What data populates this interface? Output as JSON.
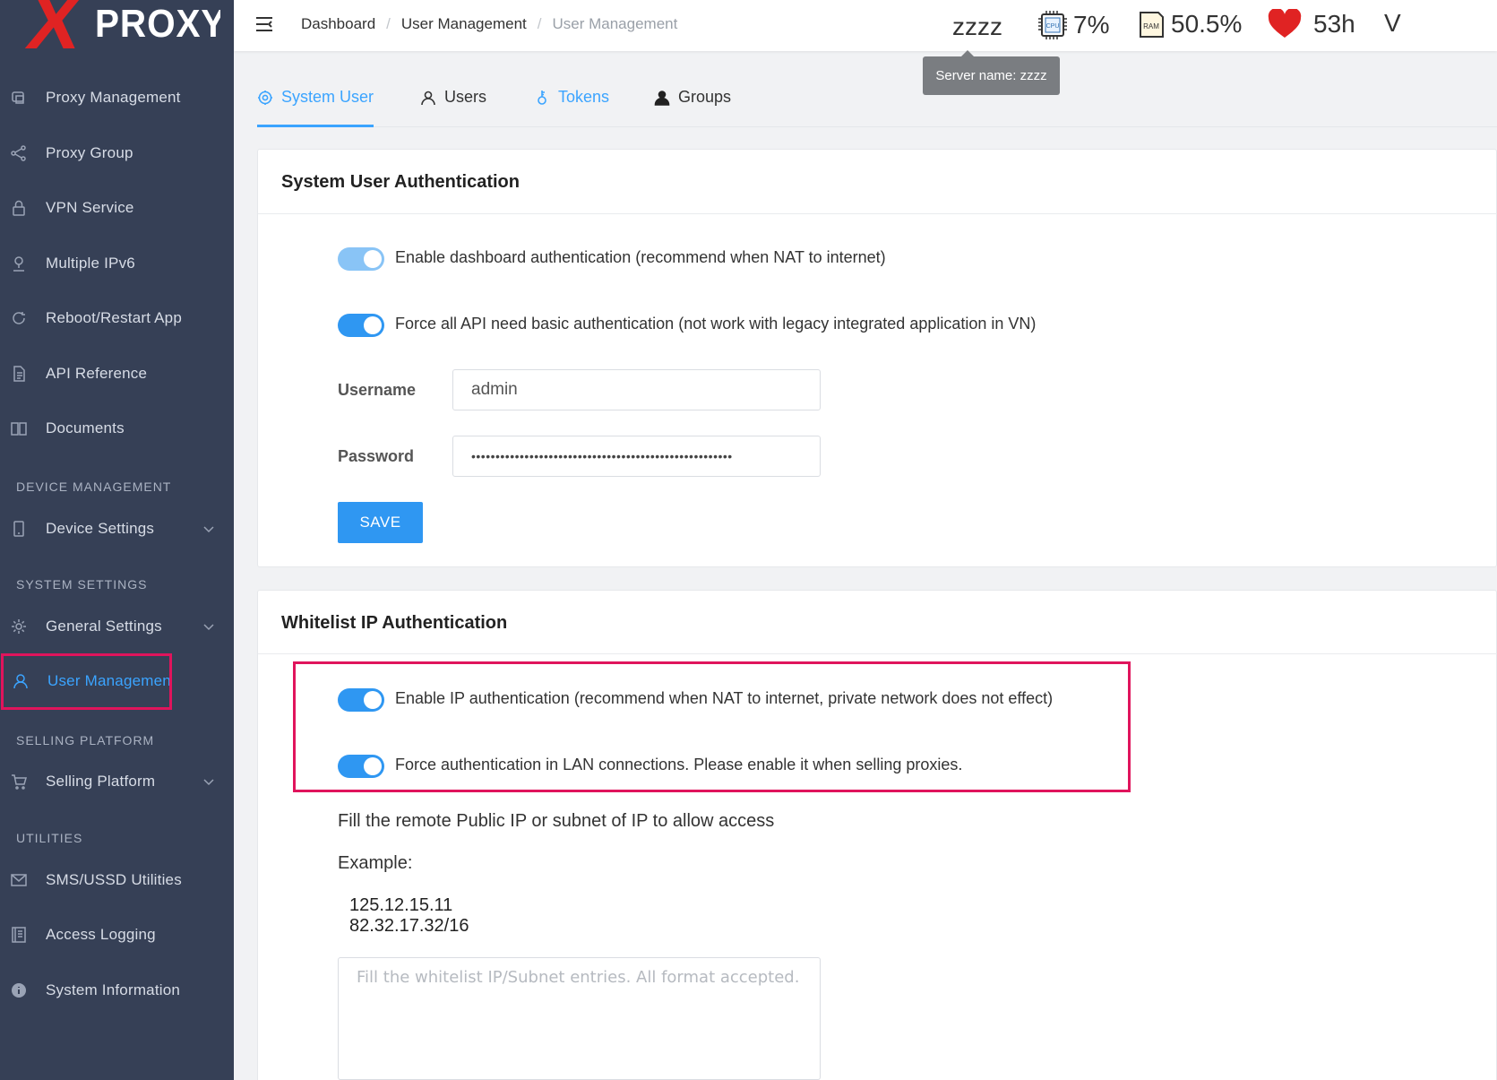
{
  "logo": {
    "x_letter": "X",
    "text": "PROXY"
  },
  "sidebar": {
    "items": [
      {
        "label": "Proxy Management",
        "icon": "proxy-management-icon"
      },
      {
        "label": "Proxy Group",
        "icon": "share-icon"
      },
      {
        "label": "VPN Service",
        "icon": "lock-icon"
      },
      {
        "label": "Multiple IPv6",
        "icon": "user-pin-icon"
      },
      {
        "label": "Reboot/Restart App",
        "icon": "refresh-icon"
      },
      {
        "label": "API Reference",
        "icon": "document-icon"
      },
      {
        "label": "Documents",
        "icon": "book-icon"
      }
    ],
    "sections": {
      "device": "DEVICE MANAGEMENT",
      "system": "SYSTEM SETTINGS",
      "selling": "SELLING PLATFORM",
      "utilities": "UTILITIES"
    },
    "device_settings": "Device Settings",
    "general_settings": "General Settings",
    "user_management": "User Management",
    "selling_platform": "Selling Platform",
    "sms_ussd": "SMS/USSD Utilities",
    "access_logging": "Access Logging",
    "system_information": "System Information"
  },
  "topbar": {
    "breadcrumbs": [
      "Dashboard",
      "User Management",
      "User Management"
    ],
    "server": "zzzz",
    "cpu": "7%",
    "ram": "50.5%",
    "uptime": "53h",
    "version_partial": "V",
    "tooltip": "Server name: zzzz"
  },
  "tabs": [
    "System User",
    "Users",
    "Tokens",
    "Groups"
  ],
  "system_user_auth": {
    "title": "System User Authentication",
    "toggle_dashboard": "Enable dashboard authentication (recommend when NAT to internet)",
    "toggle_api": "Force all API need basic authentication (not work with legacy integrated application in VN)",
    "username_label": "Username",
    "username_value": "admin",
    "password_label": "Password",
    "password_value": "••••••••••••••••••••••••••••••••••••••••••••••••••••••",
    "save_label": "SAVE"
  },
  "whitelist_auth": {
    "title": "Whitelist IP Authentication",
    "toggle_ip": "Enable IP authentication (recommend when NAT to internet, private network does not effect)",
    "toggle_lan": "Force authentication in LAN connections. Please enable it when selling proxies.",
    "hint": "Fill the remote Public IP or subnet of IP to allow access",
    "example_label": "Example:",
    "example_1": "125.12.15.11",
    "example_2": "82.32.17.32/16",
    "placeholder": "Fill the whitelist IP/Subnet entries. All format accepted."
  },
  "colors": {
    "accent": "#2f97f2",
    "sidebar_bg": "#364056",
    "highlight": "#e0145c",
    "heart": "#e02323"
  }
}
